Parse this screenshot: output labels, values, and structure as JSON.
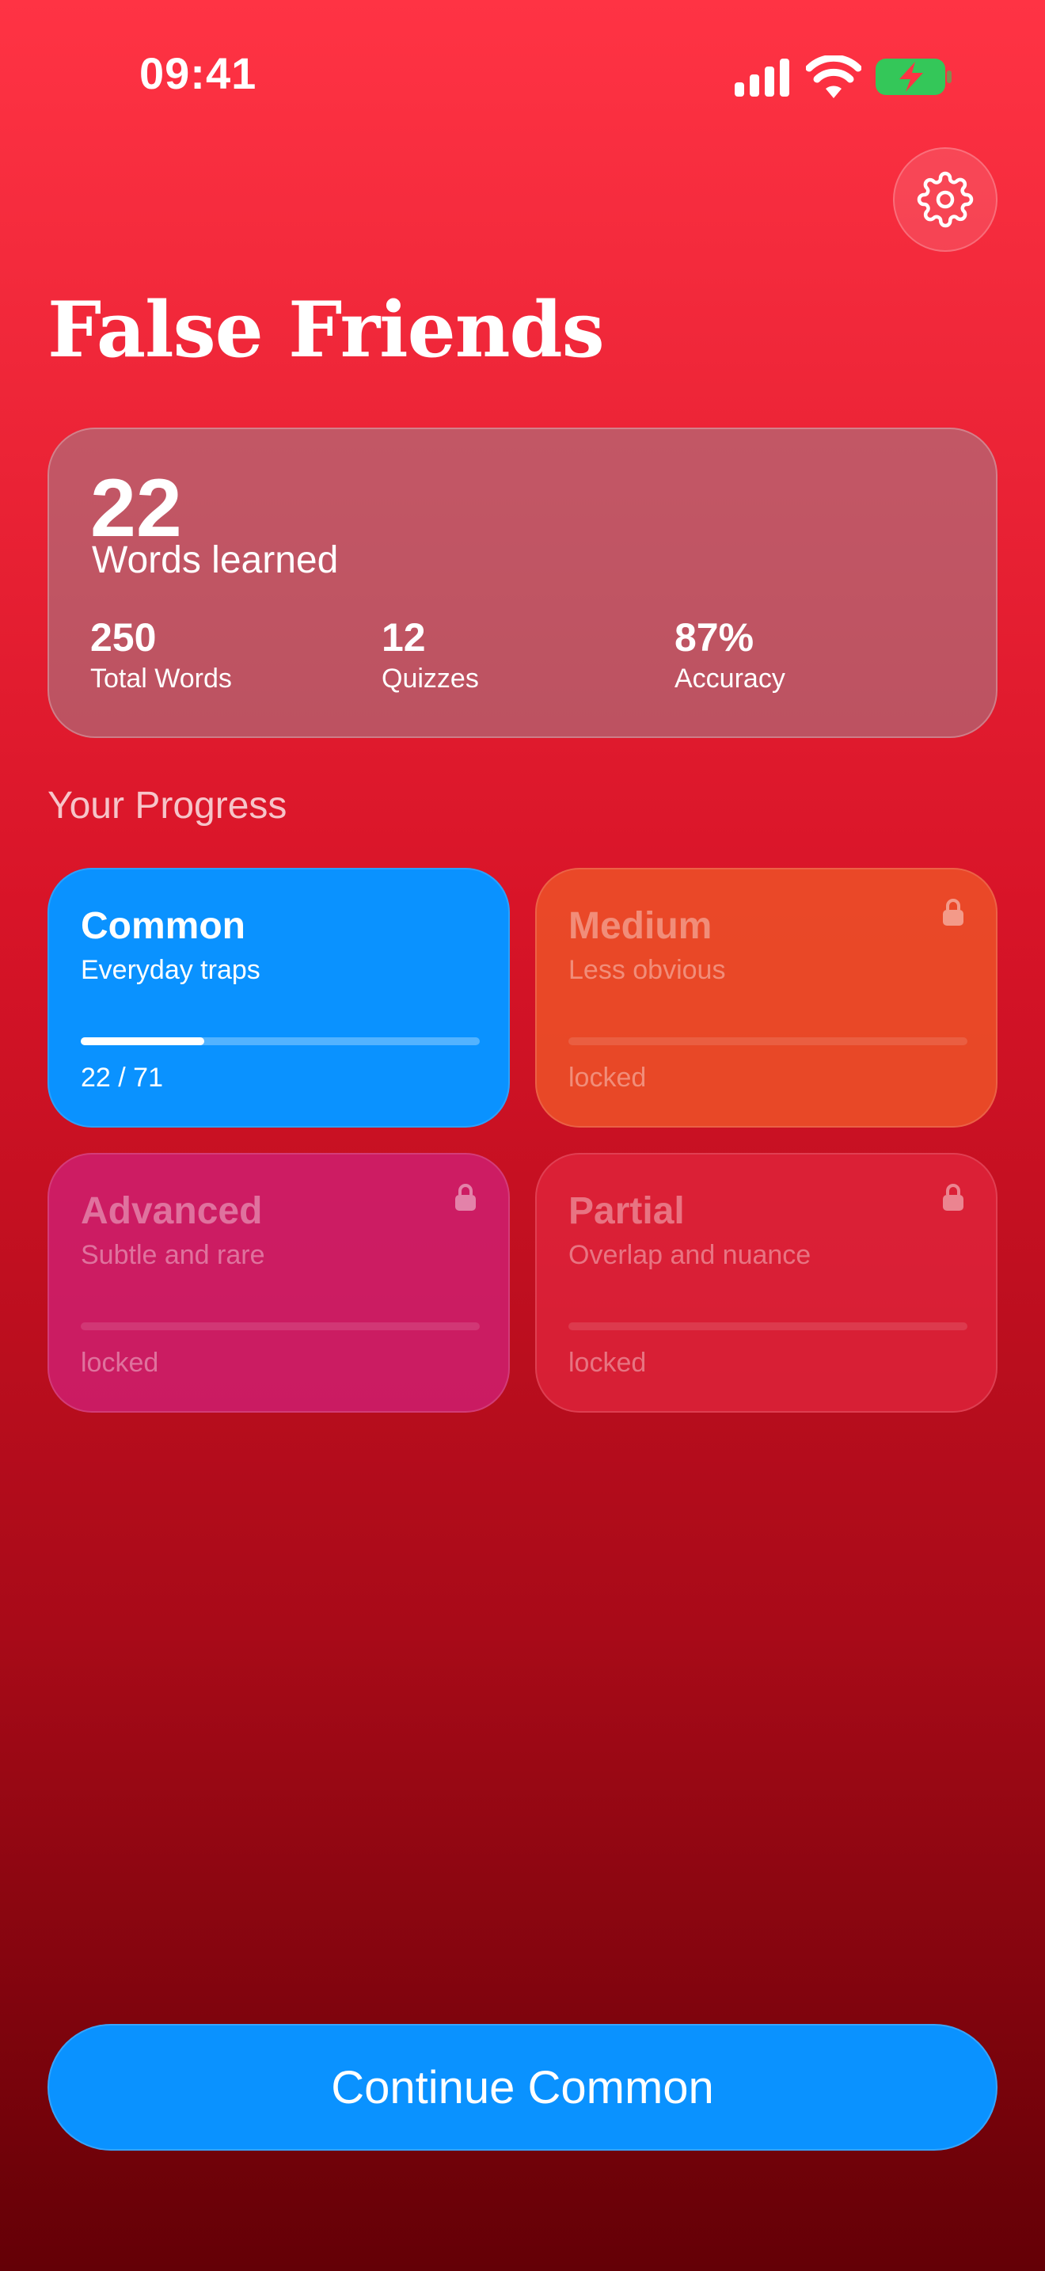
{
  "status_bar": {
    "time": "09:41"
  },
  "header": {
    "title": "False Friends",
    "settings_icon": "gear-icon"
  },
  "stats": {
    "main_value": "22",
    "main_label": "Words learned",
    "items": [
      {
        "value": "250",
        "label": "Total Words"
      },
      {
        "value": "12",
        "label": "Quizzes"
      },
      {
        "value": "87%",
        "label": "Accuracy"
      }
    ]
  },
  "progress": {
    "section_title": "Your Progress",
    "levels": [
      {
        "name": "Common",
        "description": "Everyday traps",
        "count": "22 / 71",
        "progress": 0.31,
        "locked": false,
        "color": "#0a92ff"
      },
      {
        "name": "Medium",
        "description": "Less obvious",
        "count": "locked",
        "progress": 0,
        "locked": true,
        "color": "#ec5028"
      },
      {
        "name": "Advanced",
        "description": "Subtle and rare",
        "count": "locked",
        "progress": 0,
        "locked": true,
        "color": "#ce1e6e"
      },
      {
        "name": "Partial",
        "description": "Overlap and nuance",
        "count": "locked",
        "progress": 0,
        "locked": true,
        "color": "#e2263e"
      }
    ]
  },
  "continue_button": {
    "label": "Continue Common"
  },
  "colors": {
    "accent": "#0a92ff",
    "background_top": "#ff3344",
    "background_bottom": "#640006"
  }
}
